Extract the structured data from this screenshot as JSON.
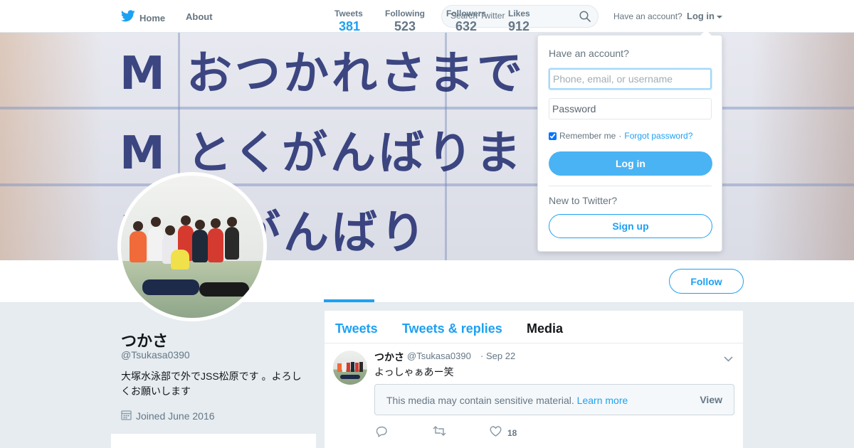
{
  "nav": {
    "home_label": "Home",
    "about_label": "About",
    "search_placeholder": "Search Twitter",
    "have_account_text": "Have an account?",
    "login_label": "Log in"
  },
  "banner": {
    "line1": "M おつかれさまで",
    "line2": "M とくがんばりま",
    "line3": "M 年がんばり"
  },
  "profile": {
    "name": "つかさ",
    "handle": "@Tsukasa0390",
    "bio": "大塚水泳部で外でJSS松原です 。よろしくお願いします",
    "joined": "Joined June 2016"
  },
  "stats": [
    {
      "label": "Tweets",
      "value": "381",
      "active": true
    },
    {
      "label": "Following",
      "value": "523",
      "active": false
    },
    {
      "label": "Followers",
      "value": "632",
      "active": false
    },
    {
      "label": "Likes",
      "value": "912",
      "active": false
    }
  ],
  "follow_label": "Follow",
  "timeline": {
    "tabs": [
      "Tweets",
      "Tweets & replies",
      "Media"
    ],
    "selected_tab": "Media",
    "tweet": {
      "name": "つかさ",
      "handle": "@Tsukasa0390",
      "separator": "·",
      "date": "Sep 22",
      "text": "よっしゃぁあー笑",
      "sensitive_text": "This media may contain sensitive material.",
      "learn_more": "Learn more",
      "view_label": "View",
      "like_count": "18"
    }
  },
  "login_dropdown": {
    "title": "Have an account?",
    "username_placeholder": "Phone, email, or username",
    "password_placeholder": "Password",
    "remember_label": "Remember me",
    "separator": "·",
    "forgot_label": "Forgot password?",
    "login_button": "Log in",
    "new_text": "New to Twitter?",
    "signup_button": "Sign up"
  },
  "colors": {
    "brand": "#1da1f2",
    "muted": "#657786",
    "background": "#e6ecf0"
  },
  "icons": [
    "twitter-bird-icon",
    "search-icon",
    "caret-down-icon",
    "calendar-icon",
    "chevron-down-icon",
    "reply-icon",
    "retweet-icon",
    "heart-icon"
  ]
}
